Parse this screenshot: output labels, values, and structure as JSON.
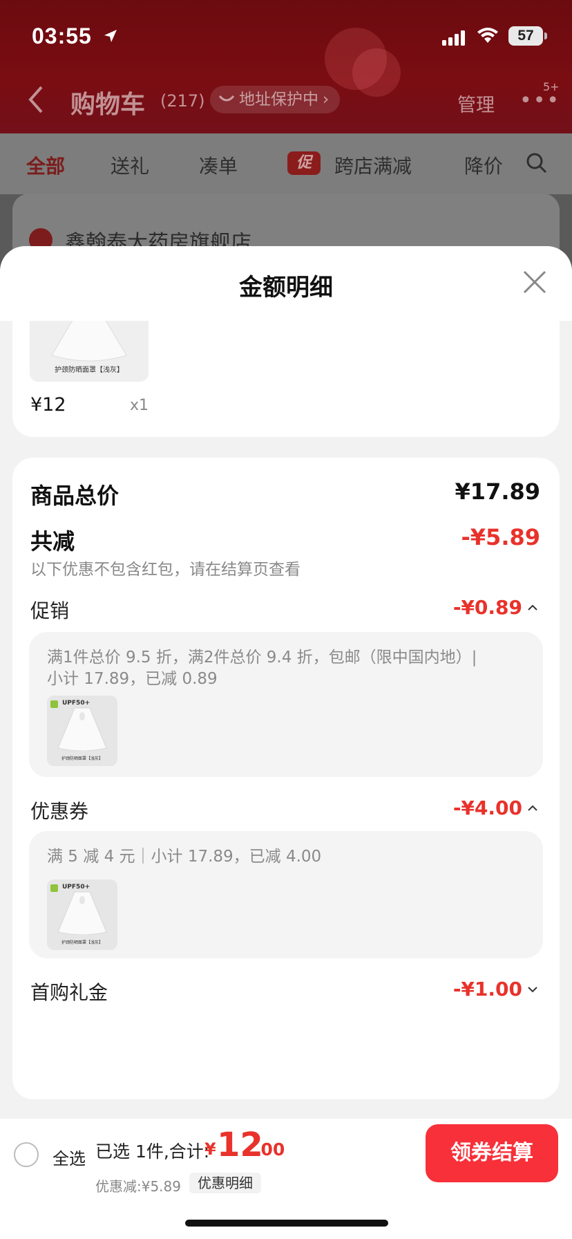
{
  "status_bar": {
    "time": "03:55",
    "battery": "57",
    "icons": [
      "location-arrow-icon",
      "signal-icon",
      "wifi-icon",
      "battery-icon"
    ]
  },
  "nav": {
    "title": "购物车",
    "count": "(217)",
    "address_protect": "地址保护中",
    "manage": "管理",
    "more_badge": "5+"
  },
  "tabs": {
    "items": [
      "全部",
      "送礼",
      "凑单",
      "跨店满减",
      "降价"
    ],
    "promo_icon_text": "促"
  },
  "store": {
    "name": "鑫翰泰大药房旗舰店"
  },
  "sheet": {
    "title": "金额明细",
    "product": {
      "caption": "护颈防晒面罩【浅灰】",
      "price": "¥12",
      "qty": "x1"
    },
    "summary": {
      "total_label": "商品总价",
      "total_value": "¥17.89",
      "reduce_label": "共减",
      "reduce_value": "-¥5.89",
      "reduce_note": "以下优惠不包含红包，请在结算页查看"
    },
    "promotion": {
      "label": "促销",
      "value": "-¥0.89",
      "detail_line1": "满1件总价 9.5 折，满2件总价 9.4 折，包邮（限中国内地）|",
      "detail_line2": "小计 17.89，已减 0.89",
      "thumb_badge": "UPF50+",
      "thumb_caption": "护颈防晒面罩【浅灰】"
    },
    "coupon": {
      "label": "优惠券",
      "value": "-¥4.00",
      "detail_line1": "满 5 减 4 元｜小计 17.89，已减 4.00",
      "thumb_badge": "UPF50+",
      "thumb_caption": "护颈防晒面罩【浅灰】"
    },
    "first_gift": {
      "label": "首购礼金",
      "value": "-¥1.00"
    }
  },
  "bottom": {
    "select_all": "全选",
    "selected_text": "已选 1件,合计:",
    "currency": "¥",
    "total_int": "12",
    "total_dec": ".00",
    "discount_text": "优惠减:¥5.89",
    "detail_button": "优惠明细",
    "checkout_button": "领券结算"
  },
  "colors": {
    "accent_red": "#e8322b",
    "checkout_red": "#f7303a",
    "header_dark_red": "#6b0b10"
  }
}
